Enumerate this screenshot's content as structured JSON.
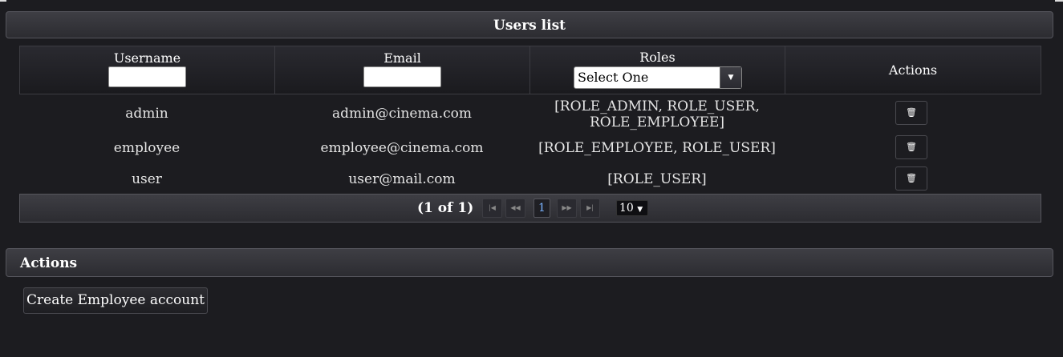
{
  "users_panel": {
    "title": "Users list"
  },
  "table": {
    "headers": {
      "username": "Username",
      "email": "Email",
      "roles": "Roles",
      "actions": "Actions"
    },
    "roles_filter": {
      "selected": "Select One"
    },
    "rows": [
      {
        "username": "admin",
        "email": "admin@cinema.com",
        "roles_line1": "[ROLE_ADMIN, ROLE_USER,",
        "roles_line2": "ROLE_EMPLOYEE]"
      },
      {
        "username": "employee",
        "email": "employee@cinema.com",
        "roles_line1": "[ROLE_EMPLOYEE, ROLE_USER]",
        "roles_line2": ""
      },
      {
        "username": "user",
        "email": "user@mail.com",
        "roles_line1": "[ROLE_USER]",
        "roles_line2": ""
      }
    ],
    "delete_icon": "trash-icon"
  },
  "paginator": {
    "info": "(1 of 1)",
    "current_page": "1",
    "rows_per_page": "10",
    "icons": [
      "first-page-icon",
      "prev-page-icon",
      "next-page-icon",
      "last-page-icon"
    ]
  },
  "actions_panel": {
    "title": "Actions",
    "create_employee_label": "Create Employee account"
  }
}
